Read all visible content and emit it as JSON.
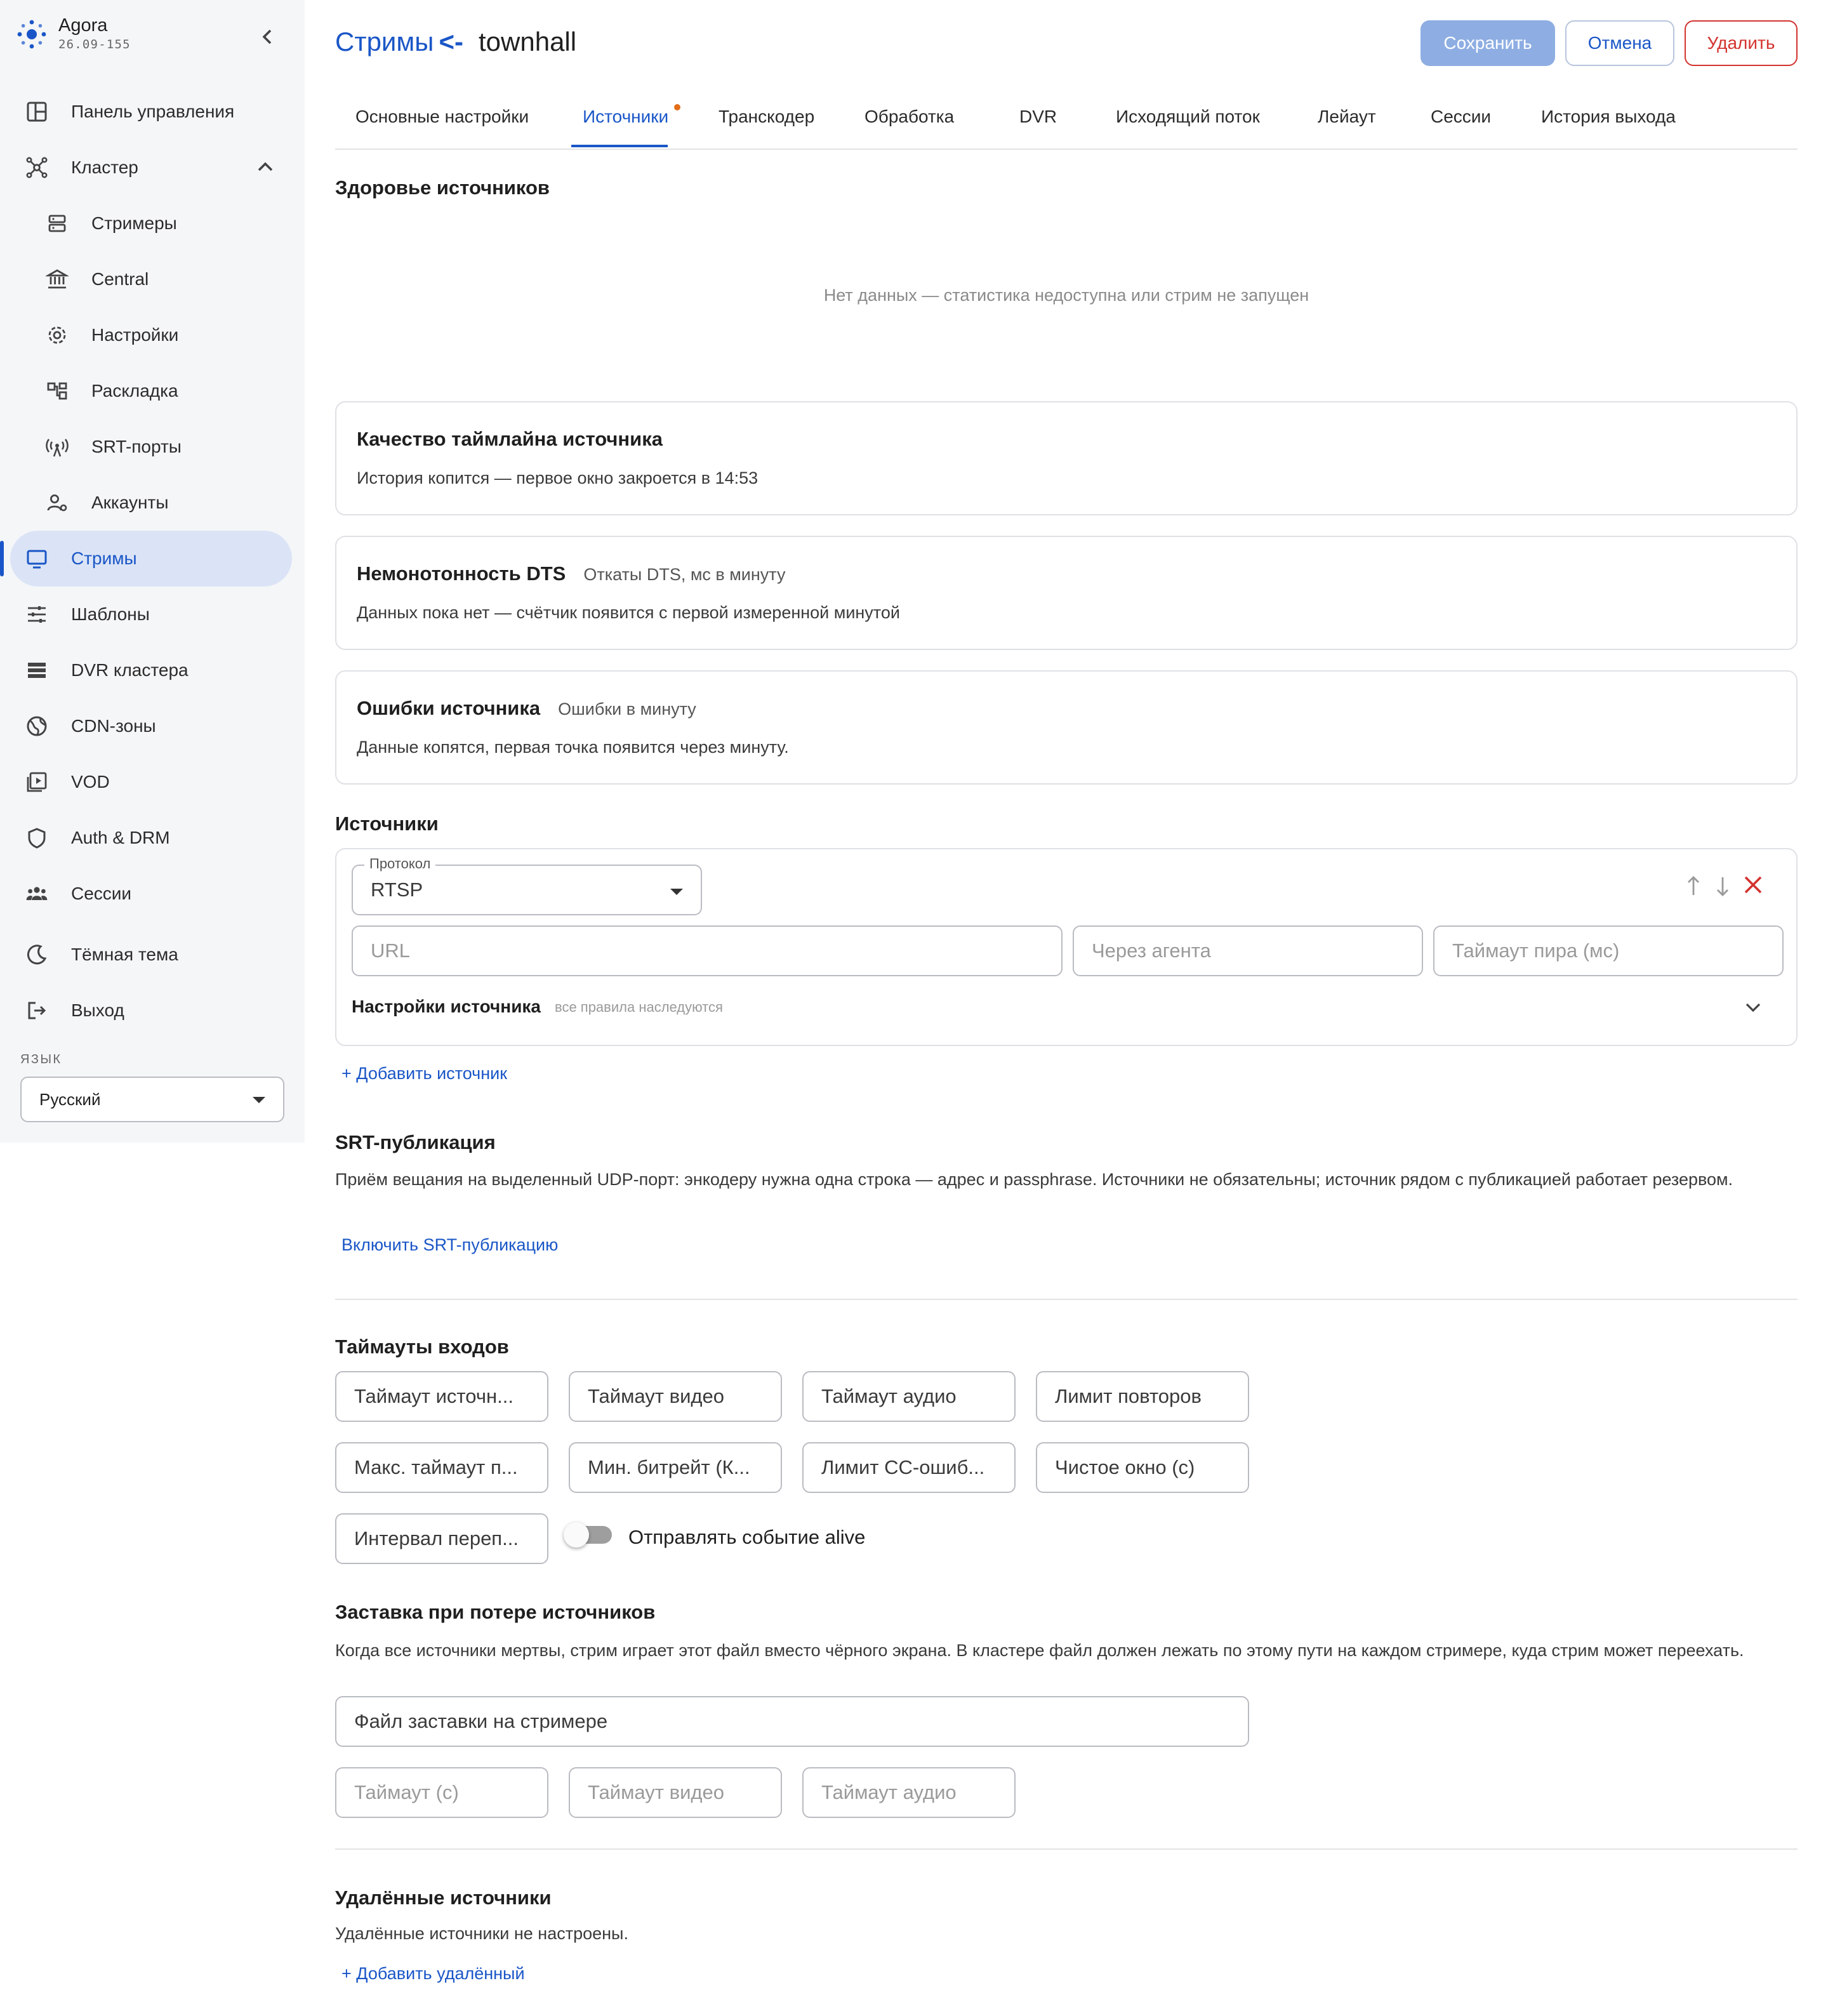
{
  "app": {
    "name": "Agora",
    "version": "26.09-155"
  },
  "sidebar": {
    "items": [
      {
        "label": "Панель управления",
        "icon": "dashboard-icon"
      },
      {
        "label": "Кластер",
        "icon": "cluster-icon",
        "expanded": true
      },
      {
        "label": "Стримеры",
        "icon": "streamers-icon",
        "sub": true
      },
      {
        "label": "Central",
        "icon": "bank-icon",
        "sub": true
      },
      {
        "label": "Настройки",
        "icon": "gear-icon",
        "sub": true
      },
      {
        "label": "Раскладка",
        "icon": "layout-icon",
        "sub": true
      },
      {
        "label": "SRT-порты",
        "icon": "antenna-icon",
        "sub": true
      },
      {
        "label": "Аккаунты",
        "icon": "accounts-icon",
        "sub": true
      },
      {
        "label": "Стримы",
        "icon": "monitor-icon",
        "active": true
      },
      {
        "label": "Шаблоны",
        "icon": "sliders-icon"
      },
      {
        "label": "DVR кластера",
        "icon": "storage-icon"
      },
      {
        "label": "CDN-зоны",
        "icon": "globe-icon"
      },
      {
        "label": "VOD",
        "icon": "video-library-icon"
      },
      {
        "label": "Auth & DRM",
        "icon": "shield-icon"
      },
      {
        "label": "Сессии",
        "icon": "people-icon"
      },
      {
        "label": "Тёмная тема",
        "icon": "moon-icon"
      },
      {
        "label": "Выход",
        "icon": "logout-icon"
      }
    ],
    "language": {
      "label": "Язык",
      "value": "Русский"
    }
  },
  "header": {
    "breadcrumb": "Стримы",
    "back_arrow": "<-",
    "title": "townhall",
    "save": "Сохранить",
    "cancel": "Отмена",
    "delete": "Удалить"
  },
  "tabs": [
    {
      "label": "Основные настройки"
    },
    {
      "label": "Источники",
      "active": true
    },
    {
      "label": "Транскодер"
    },
    {
      "label": "Обработка"
    },
    {
      "label": "DVR"
    },
    {
      "label": "Исходящий поток"
    },
    {
      "label": "Лейаут"
    },
    {
      "label": "Сессии"
    },
    {
      "label": "История выхода"
    }
  ],
  "health": {
    "title": "Здоровье источников",
    "empty": "Нет данных — статистика недоступна или стрим не запущен"
  },
  "cards": {
    "timeline": {
      "title": "Качество таймлайна источника",
      "body": "История копится — первое окно закроется в 14:53"
    },
    "dts": {
      "title": "Немонотонность DTS",
      "subtitle": "Откаты DTS, мс в минуту",
      "body": "Данных пока нет — счётчик появится с первой измеренной минутой"
    },
    "errors": {
      "title": "Ошибки источника",
      "subtitle": "Ошибки в минуту",
      "body": "Данные копятся, первая точка появится через минуту."
    }
  },
  "sources": {
    "title": "Источники",
    "protocol_label": "Протокол",
    "protocol_value": "RTSP",
    "url_placeholder": "URL",
    "agent_placeholder": "Через агента",
    "peer_timeout_placeholder": "Таймаут пира (мс)",
    "settings_title": "Настройки источника",
    "settings_hint": "все правила наследуются",
    "add": "+ Добавить источник"
  },
  "srt": {
    "title": "SRT-публикация",
    "description": "Приём вещания на выделенный UDP-порт: энкодеру нужна одна строка — адрес и passphrase. Источники не обязательны; источник рядом с публикацией работает резервом.",
    "enable": "Включить SRT-публикацию"
  },
  "timeouts": {
    "title": "Таймауты входов",
    "fields": [
      "Таймаут источн...",
      "Таймаут видео",
      "Таймаут аудио",
      "Лимит повторов",
      "Макс. таймаут п...",
      "Мин. битрейт (К...",
      "Лимит CC-ошиб...",
      "Чистое окно (с)",
      "Интервал переп..."
    ],
    "alive_label": "Отправлять событие alive",
    "alive_enabled": false
  },
  "fallback": {
    "title": "Заставка при потере источников",
    "description": "Когда все источники мертвы, стрим играет этот файл вместо чёрного экрана. В кластере файл должен лежать по этому пути на каждом стримере, куда стрим может переехать.",
    "file_placeholder": "Файл заставки на стримере",
    "timeout_placeholder": "Таймаут (с)",
    "video_placeholder": "Таймаут видео",
    "audio_placeholder": "Таймаут аудио"
  },
  "remote": {
    "title": "Удалённые источники",
    "empty": "Удалённые источники не настроены.",
    "add": "+ Добавить удалённый"
  },
  "colors": {
    "accent": "#1a56c7",
    "danger": "#d3332f",
    "active_pill": "#dbe4f6",
    "tab_dot": "#e36d19"
  }
}
